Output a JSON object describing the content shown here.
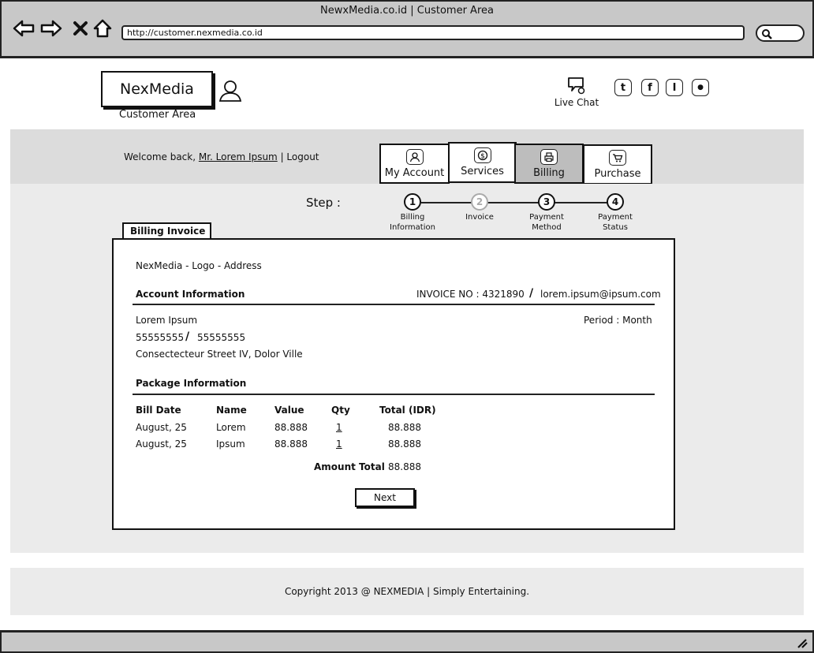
{
  "browser": {
    "window_title": "NewxMedia.co.id | Customer Area",
    "url": "http://customer.nexmedia.co.id",
    "icons": [
      "back-arrow-icon",
      "forward-arrow-icon",
      "stop-icon",
      "home-icon",
      "search-icon"
    ]
  },
  "header": {
    "logo": "NexMedia",
    "subtitle": "Customer Area",
    "live_chat": "Live Chat",
    "social_icons": [
      "twitter-icon",
      "facebook-icon",
      "tumblr-icon",
      "flickr-icon"
    ],
    "social_glyphs": [
      "t",
      "f",
      "I",
      "●"
    ]
  },
  "welcome": {
    "prefix": "Welcome back, ",
    "user": "Mr. Lorem Ipsum",
    "separator": " | ",
    "logout": "Logout"
  },
  "tabs": [
    {
      "label": "My Account",
      "icon": "account-icon"
    },
    {
      "label": "Services",
      "icon": "dollar-icon"
    },
    {
      "label": "Billing",
      "icon": "printer-icon"
    },
    {
      "label": "Purchase",
      "icon": "cart-icon"
    }
  ],
  "steps": {
    "label": "Step :",
    "items": [
      {
        "number": "1",
        "line1": "Billing",
        "line2": "Information"
      },
      {
        "number": "2",
        "line1": "Invoice",
        "line2": ""
      },
      {
        "number": "3",
        "line1": "Payment",
        "line2": "Method"
      },
      {
        "number": "4",
        "line1": "Payment",
        "line2": "Status"
      }
    ]
  },
  "invoice": {
    "tab_label": "Billing Invoice",
    "company_line": "NexMedia - Logo - Address",
    "account_heading": "Account Information",
    "invoice_no": "INVOICE NO : 4321890",
    "email": "lorem.ipsum@ipsum.com",
    "name": "Lorem Ipsum",
    "period": "Period : Month",
    "phone1": "55555555",
    "phone2": "55555555",
    "address": "Consectecteur Street IV, Dolor Ville",
    "package_heading": "Package Information",
    "columns": [
      "Bill Date",
      "Name",
      "Value",
      "Qty",
      "Total (IDR)"
    ],
    "rows": [
      [
        "August, 25",
        "Lorem",
        "88.888",
        "1",
        "88.888"
      ],
      [
        "August, 25",
        "Ipsum",
        "88.888",
        "1",
        "88.888"
      ]
    ],
    "amount_total_label": "Amount Total",
    "amount_total_value": "88.888",
    "next_button": "Next"
  },
  "footer": {
    "copyright": "Copyright 2013 @ NEXMEDIA | Simply Entertaining."
  }
}
